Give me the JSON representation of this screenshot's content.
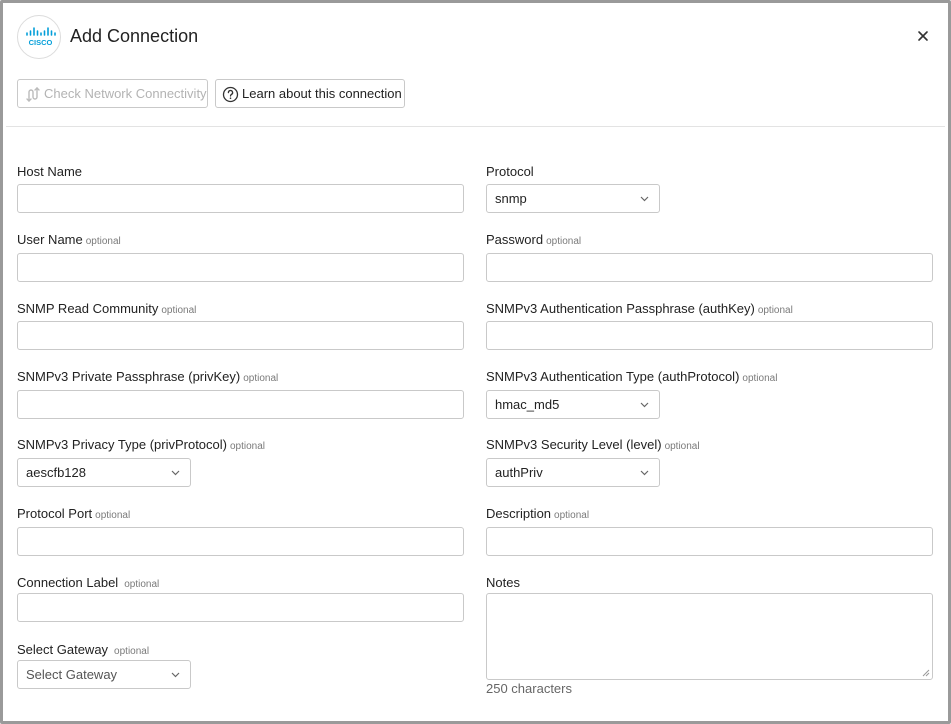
{
  "dialog": {
    "title": "Add Connection",
    "logo_text": "CISCO",
    "brand_color": "#049fd9"
  },
  "toolbar": {
    "check_label": "Check Network Connectivity",
    "learn_label": "Learn about this connection"
  },
  "fields": {
    "host_name": {
      "label": "Host Name",
      "value": ""
    },
    "protocol": {
      "label": "Protocol",
      "value": "snmp"
    },
    "user_name": {
      "label": "User Name",
      "optional": "optional",
      "value": ""
    },
    "password": {
      "label": "Password",
      "optional": "optional",
      "value": ""
    },
    "snmp_read_community": {
      "label": "SNMP Read Community",
      "optional": "optional",
      "value": ""
    },
    "auth_key": {
      "label": "SNMPv3 Authentication Passphrase (authKey)",
      "optional": "optional",
      "value": ""
    },
    "priv_key": {
      "label": "SNMPv3 Private Passphrase (privKey)",
      "optional": "optional",
      "value": ""
    },
    "auth_protocol": {
      "label": "SNMPv3 Authentication Type (authProtocol)",
      "optional": "optional",
      "value": "hmac_md5"
    },
    "priv_protocol": {
      "label": "SNMPv3 Privacy Type (privProtocol)",
      "optional": "optional",
      "value": "aescfb128"
    },
    "security_level": {
      "label": "SNMPv3 Security Level (level)",
      "optional": "optional",
      "value": "authPriv"
    },
    "protocol_port": {
      "label": "Protocol Port",
      "optional": "optional",
      "value": ""
    },
    "description": {
      "label": "Description",
      "optional": "optional",
      "value": ""
    },
    "connection_label": {
      "label": "Connection Label",
      "optional": "optional",
      "value": ""
    },
    "notes": {
      "label": "Notes",
      "value": "",
      "char_count": "250 characters"
    },
    "gateway": {
      "label": "Select Gateway",
      "optional": "optional",
      "value": "Select Gateway"
    }
  }
}
